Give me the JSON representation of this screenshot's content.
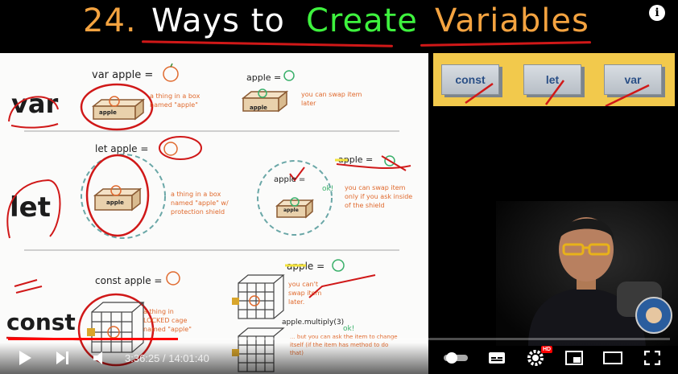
{
  "title": {
    "number": "24.",
    "part1": "Ways to",
    "part2": "Create",
    "part3": "Variables"
  },
  "board": {
    "var": {
      "label": "var",
      "heading": "var apple =",
      "box_label": "apple",
      "note1": "a thing in a box named \"apple\"",
      "heading2": "apple =",
      "box_label2": "apple",
      "note2": "you can swap item later"
    },
    "let": {
      "label": "let",
      "heading": "let apple =",
      "box_label": "apple",
      "note1": "a thing in a box named \"apple\" w/ protection shield",
      "heading_ok": "apple =",
      "ok": "ok!",
      "box_label2": "apple",
      "note2": "you can swap item only if you ask inside of the shield",
      "crossed": "apple ="
    },
    "const": {
      "label": "const",
      "heading": "const apple =",
      "note1": "a thing in LOCKED cage named \"apple\"",
      "crossed": "apple =",
      "note2": "you can't swap item later.",
      "method": "apple.multiply(3)",
      "ok": "ok!",
      "note3": "... but you can ask the item to change itself (if the item has method to do that)"
    }
  },
  "keywords": [
    "const",
    "let",
    "var"
  ],
  "controls": {
    "time": "3:36:25 / 14:01:40",
    "hd": "HD",
    "progress": 0.257
  },
  "colors": {
    "accent": "#ff0000",
    "title_orange": "#f4a340",
    "title_green": "#3ef23e",
    "panel": "#f2c94c"
  },
  "icons": [
    "play-icon",
    "next-icon",
    "volume-icon",
    "autoplay-toggle-icon",
    "subtitles-icon",
    "settings-icon",
    "miniplayer-icon",
    "theater-icon",
    "fullscreen-icon",
    "info-icon"
  ]
}
